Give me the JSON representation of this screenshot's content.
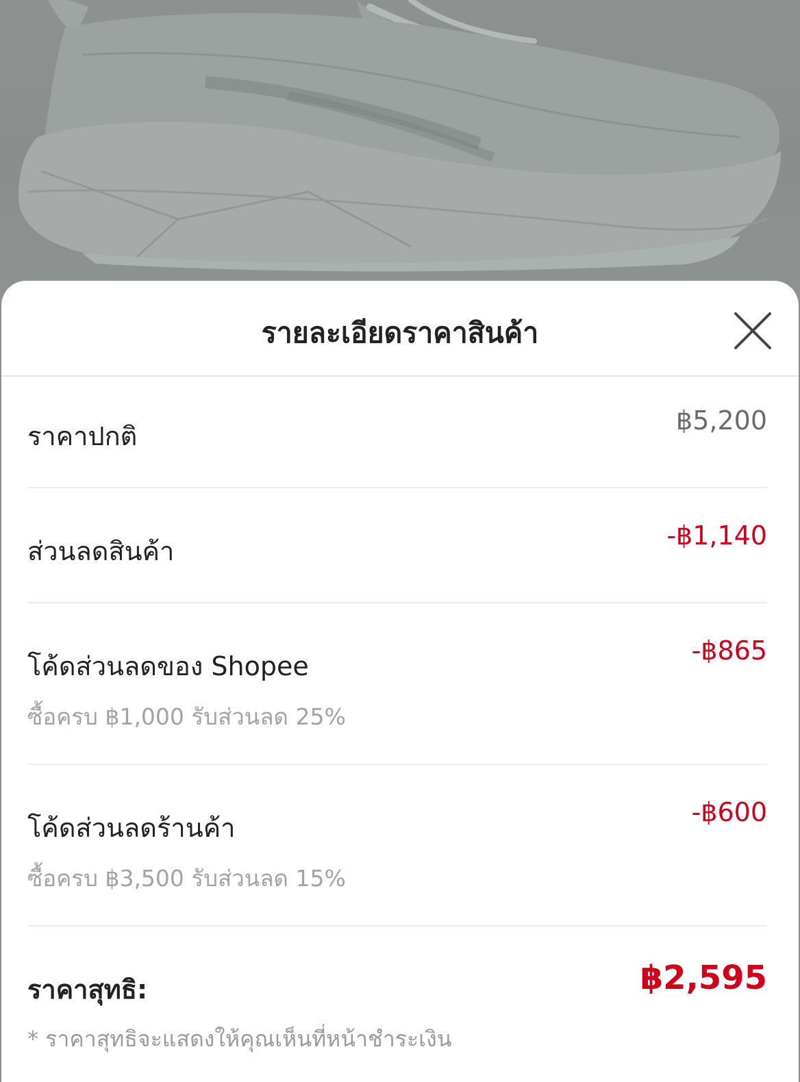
{
  "product_image": {
    "subject": "running-shoe"
  },
  "sheet": {
    "title": "รายละเอียดราคาสินค้า",
    "close_icon": "close-icon"
  },
  "rows": [
    {
      "label": "ราคาปกติ",
      "value": "฿5,200",
      "sub": ""
    },
    {
      "label": "ส่วนลดสินค้า",
      "value": "-฿1,140",
      "sub": ""
    },
    {
      "label": "โค้ดส่วนลดของ Shopee",
      "value": "-฿865",
      "sub": "ซื้อครบ ฿1,000 รับส่วนลด 25%"
    },
    {
      "label": "โค้ดส่วนลดร้านค้า",
      "value": "-฿600",
      "sub": "ซื้อครบ ฿3,500 รับส่วนลด 15%"
    }
  ],
  "total": {
    "label": "ราคาสุทธิ:",
    "value": "฿2,595"
  },
  "footnote": "* ราคาสุทธิจะแสดงให้คุณเห็นที่หน้าชำระเงิน",
  "colors": {
    "discount": "#d0011b",
    "overlay": "#8a8f8c"
  }
}
